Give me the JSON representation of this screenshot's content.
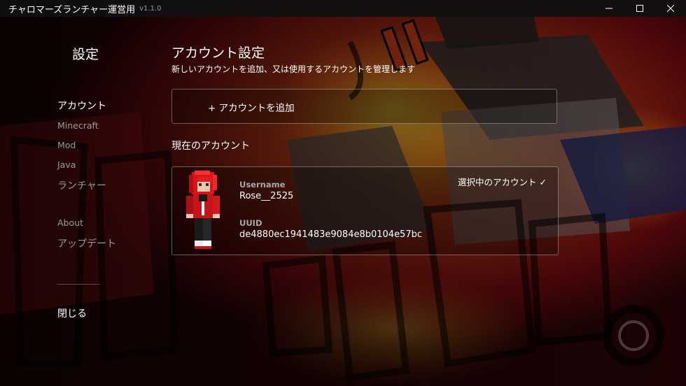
{
  "app": {
    "title": "チャロマーズランチャー運営用",
    "version": "v1.1.0"
  },
  "window_controls": {
    "minimize_icon": "minimize-icon",
    "maximize_icon": "maximize-icon",
    "close_icon": "close-icon"
  },
  "sidebar": {
    "title": "設定",
    "items": [
      {
        "label": "アカウント",
        "active": true
      },
      {
        "label": "Minecraft",
        "active": false
      },
      {
        "label": "Mod",
        "active": false
      },
      {
        "label": "Java",
        "active": false
      },
      {
        "label": "ランチャー",
        "active": false
      },
      {
        "label": "About",
        "active": false
      },
      {
        "label": "アップデート",
        "active": false
      }
    ],
    "close_label": "閉じる"
  },
  "main": {
    "title": "アカウント設定",
    "subtitle": "新しいアカウントを追加、又は使用するアカウントを管理します",
    "add_account_label": "+ アカウントを追加",
    "current_heading": "現在のアカウント",
    "account": {
      "username_label": "Username",
      "username": "Rose__2525",
      "uuid_label": "UUID",
      "uuid": "de4880ec1941483e9084e8b0104e57bc",
      "selected_text": "選択中のアカウント ✓",
      "skin_icon": "player-skin-avatar"
    }
  },
  "colors": {
    "accent": "#ffffff",
    "muted_text": "#9b9b9b",
    "background_red": "#8c0d12",
    "background_orange": "#f2a11c"
  }
}
